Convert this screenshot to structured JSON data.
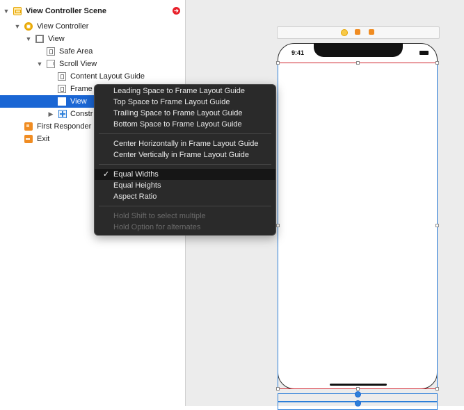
{
  "outline": {
    "items": [
      {
        "label": "View Controller Scene",
        "icon": "scene-icon",
        "disclosure": "▼"
      },
      {
        "label": "View Controller",
        "icon": "view-controller-icon",
        "disclosure": "▼"
      },
      {
        "label": "View",
        "icon": "view-icon",
        "disclosure": "▼"
      },
      {
        "label": "Safe Area",
        "icon": "layout-guide-icon",
        "disclosure": ""
      },
      {
        "label": "Scroll View",
        "icon": "scroll-view-icon",
        "disclosure": "▼"
      },
      {
        "label": "Content Layout Guide",
        "icon": "layout-guide-icon",
        "disclosure": ""
      },
      {
        "label": "Frame",
        "icon": "layout-guide-icon",
        "disclosure": ""
      },
      {
        "label": "View",
        "icon": "view-icon",
        "disclosure": ""
      },
      {
        "label": "Constr",
        "icon": "constraints-icon",
        "disclosure": "▶"
      },
      {
        "label": "First Responder",
        "icon": "first-responder-icon",
        "disclosure": ""
      },
      {
        "label": "Exit",
        "icon": "exit-icon",
        "disclosure": ""
      }
    ],
    "selected_index": 7,
    "warning_icon": "error-indicator-icon"
  },
  "canvas": {
    "status_time": "9:41",
    "scene_bar_icons": [
      "view-controller-icon",
      "first-responder-icon",
      "exit-icon"
    ]
  },
  "context_menu": {
    "items": [
      {
        "label": "Leading Space to Frame Layout Guide",
        "checked": false,
        "enabled": true
      },
      {
        "label": "Top Space to Frame Layout Guide",
        "checked": false,
        "enabled": true
      },
      {
        "label": "Trailing Space to Frame Layout Guide",
        "checked": false,
        "enabled": true
      },
      {
        "label": "Bottom Space to Frame Layout Guide",
        "checked": false,
        "enabled": true
      },
      {
        "label": "Center Horizontally in Frame Layout Guide",
        "checked": false,
        "enabled": true
      },
      {
        "label": "Center Vertically in Frame Layout Guide",
        "checked": false,
        "enabled": true
      },
      {
        "label": "Equal Widths",
        "checked": true,
        "enabled": true
      },
      {
        "label": "Equal Heights",
        "checked": false,
        "enabled": true
      },
      {
        "label": "Aspect Ratio",
        "checked": false,
        "enabled": true
      },
      {
        "label": "Hold Shift to select multiple",
        "checked": false,
        "enabled": false
      },
      {
        "label": "Hold Option for alternates",
        "checked": false,
        "enabled": false
      }
    ],
    "checkmark": "✓"
  },
  "colors": {
    "selection": "#1a66d4",
    "menu_background": "#2a2a2a",
    "constraint_red": "#d0202a",
    "frame_blue": "#2d7fd9"
  }
}
